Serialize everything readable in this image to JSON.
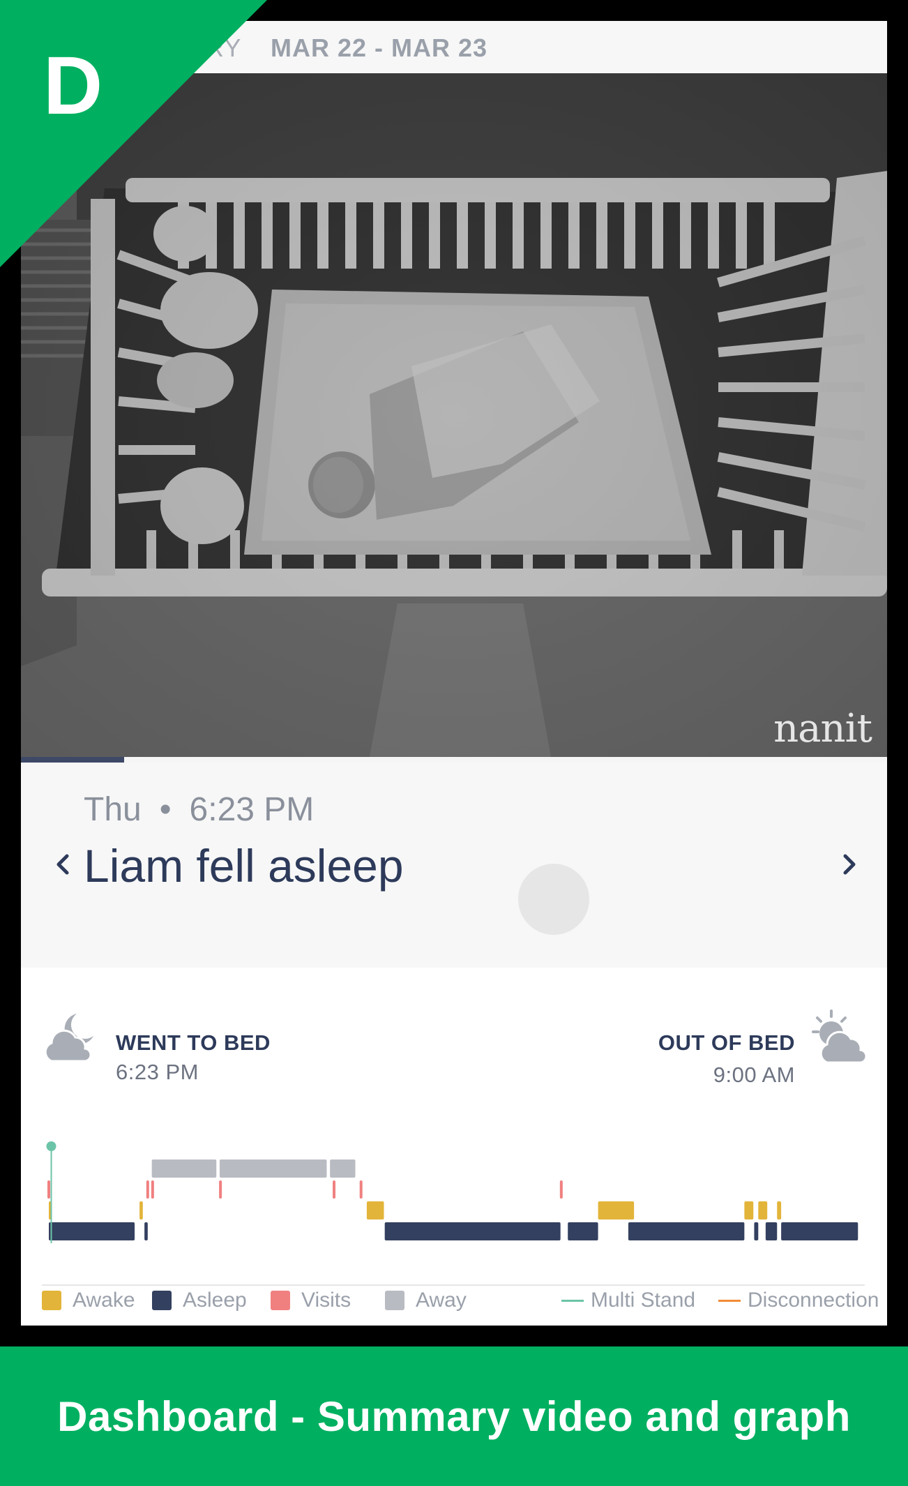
{
  "badge": {
    "letter": "D",
    "color": "#00b060"
  },
  "header": {
    "summary_prefix": "ARY",
    "date_range": "MAR 22 - MAR 23"
  },
  "video": {
    "watermark": "nanit",
    "progress": 0.12
  },
  "event": {
    "day": "Thu",
    "separator": "•",
    "time": "6:23 PM",
    "title": "Liam fell asleep"
  },
  "bed": {
    "went_to_bed_label": "WENT TO BED",
    "went_to_bed_time": "6:23 PM",
    "out_of_bed_label": "OUT OF BED",
    "out_of_bed_time": "9:00 AM",
    "went_to_bed_icon": "cloud-moon-icon",
    "out_of_bed_icon": "cloud-sun-icon"
  },
  "chart_data": {
    "type": "timeline",
    "x_unit": "fraction of night (6:23 PM to 9:00 AM)",
    "colors": {
      "awake": "#e3b43a",
      "asleep": "#33405f",
      "visits": "#f08080",
      "away": "#b9bbc2",
      "multi_stand": "#6cc4a8",
      "disconnection": "#f28c38"
    },
    "asleep": [
      [
        0.0,
        0.105
      ],
      [
        0.117,
        0.121
      ],
      [
        0.411,
        0.626
      ],
      [
        0.635,
        0.672
      ],
      [
        0.709,
        0.851
      ],
      [
        0.863,
        0.868
      ],
      [
        0.877,
        0.891
      ],
      [
        0.896,
        0.99
      ]
    ],
    "awake": [
      [
        0.0,
        0.003
      ],
      [
        0.111,
        0.115
      ],
      [
        0.389,
        0.41
      ],
      [
        0.672,
        0.716
      ],
      [
        0.851,
        0.862
      ],
      [
        0.868,
        0.879
      ],
      [
        0.891,
        0.896
      ]
    ],
    "visits": [
      0.0,
      0.121,
      0.127,
      0.21,
      0.349,
      0.382,
      0.627
    ],
    "away": [
      [
        0.126,
        0.205
      ],
      [
        0.209,
        0.34
      ],
      [
        0.344,
        0.375
      ]
    ],
    "multi_stand": [
      0.003
    ]
  },
  "legend": {
    "awake": "Awake",
    "asleep": "Asleep",
    "visits": "Visits",
    "away": "Away",
    "multi_stand": "Multi Stand",
    "disconnection": "Disconnection"
  },
  "footer": {
    "caption": "Dashboard - Summary video and graph"
  }
}
